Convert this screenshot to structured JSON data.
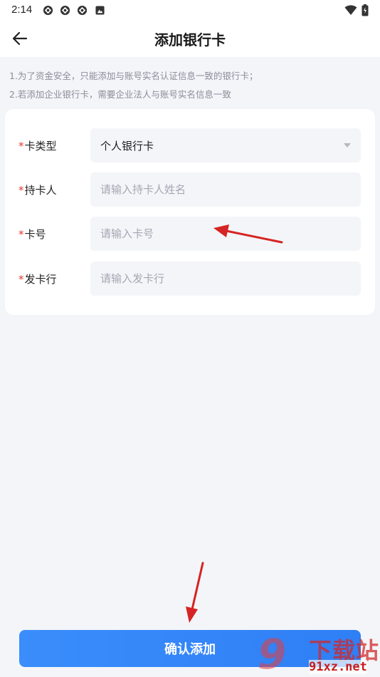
{
  "status_bar": {
    "time": "2:14",
    "icons": [
      "app-notify-icon",
      "app-notify-icon",
      "app-notify-icon",
      "photo-notify-icon"
    ],
    "right_icons": [
      "wifi-icon",
      "battery-icon"
    ]
  },
  "header": {
    "title": "添加银行卡",
    "back_icon": "back-arrow-icon"
  },
  "notes": {
    "line1": "1.为了资金安全，只能添加与账号实名认证信息一致的银行卡；",
    "line2": "2.若添加企业银行卡，需要企业法人与账号实名信息一致"
  },
  "form": {
    "required_mark": "*",
    "card_type": {
      "label": "卡类型",
      "value": "个人银行卡"
    },
    "holder": {
      "label": "持卡人",
      "placeholder": "请输入持卡人姓名"
    },
    "card_number": {
      "label": "卡号",
      "placeholder": "请输入卡号"
    },
    "bank": {
      "label": "发卡行",
      "placeholder": "请输入发卡行"
    }
  },
  "confirm_button": {
    "label": "确认添加"
  },
  "watermark": {
    "brand": "下载站",
    "url": "91xz.net",
    "digit": "9"
  },
  "colors": {
    "accent": "#3385f8",
    "required": "#e53935",
    "annotation_arrow": "#d62424",
    "background": "#f4f5f9"
  }
}
